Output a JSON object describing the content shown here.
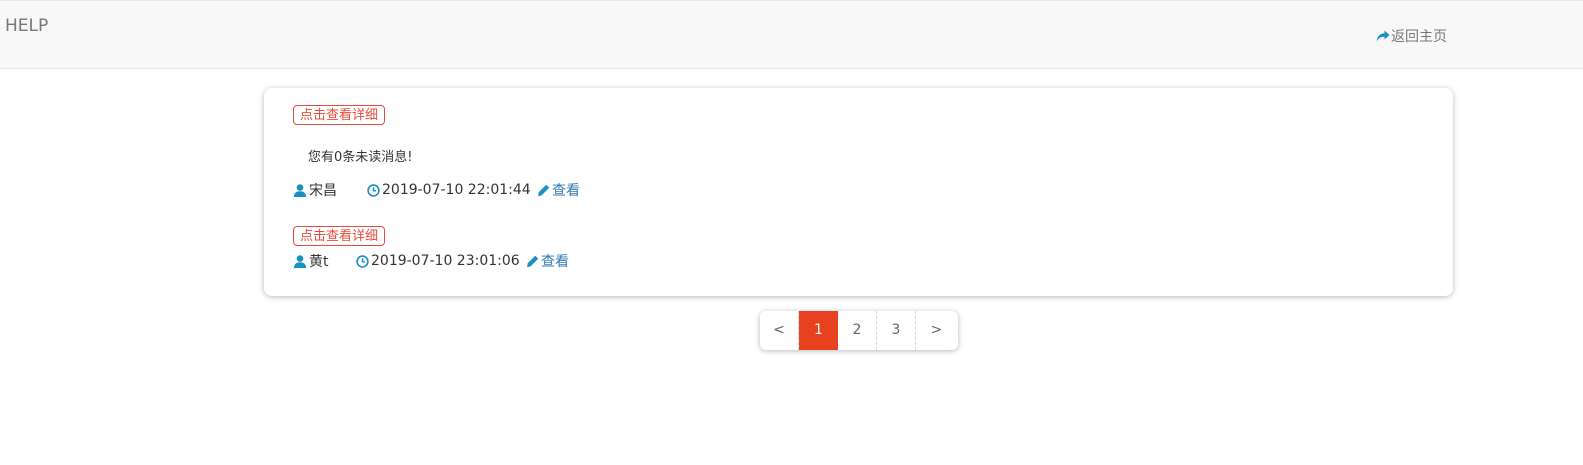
{
  "navbar": {
    "brand": "HELP",
    "home_link": "返回主页"
  },
  "messages": [
    {
      "tag": "点击查看详细",
      "text": "您有0条未读消息!",
      "author": "宋昌",
      "time": "2019-07-10 22:01:44",
      "view_label": "查看"
    },
    {
      "tag": "点击查看详细",
      "author": "黄t",
      "time": "2019-07-10 23:01:06",
      "view_label": "查看"
    }
  ],
  "pagination": {
    "prev": "<",
    "pages": [
      "1",
      "2",
      "3"
    ],
    "current": "1",
    "next": ">"
  },
  "colors": {
    "accent": "#e8411f",
    "icon": "#1a8fc4",
    "link": "#337ab7"
  },
  "icons": {
    "home": "share-arrow-icon",
    "author": "user-icon",
    "time": "clock-icon",
    "view": "pencil-icon"
  }
}
